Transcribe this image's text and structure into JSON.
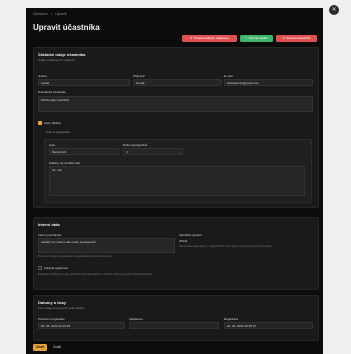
{
  "breadcrumb": {
    "parent": "Účastníci",
    "separator": ">",
    "current": "Upravit"
  },
  "page_title": "Upravit účastníka",
  "header_buttons": {
    "delete_pending": "Smazat čekající registrace",
    "approve": "Potvrdit platbu",
    "delete": "Smazat účastníka"
  },
  "basic": {
    "title": "Základní údaje účastníka",
    "subtitle": "Údaje uváděné při registraci",
    "first_name_label": "Jméno",
    "first_name_value": "Lukáš",
    "last_name_label": "Příjmení*",
    "last_name_value": "Novák",
    "email_label": "E-mail",
    "email_value": "lukasadmin@gmail.com",
    "note_label": "Poznámka účastníka",
    "note_value": "Mohla přijet sestřička",
    "driver_label": "Auto/ řidička",
    "car_section_label": "Auto a spolujezdci",
    "car_label": "Auto",
    "car_value": "Škoda 022",
    "seats_label": "Počet spolujezdců",
    "seats_value": "4",
    "extra_label": "Odkazy na sociální sítě",
    "extra_value": "IG: mia"
  },
  "internal": {
    "title": "Interní data",
    "note_label": "Interní poznámka",
    "note_value": "zaplatil na místě podle počtu spolujezdců",
    "note_hint": "Pouze pro účely zaměstnanců a organizátorů, účastník je nevidí",
    "symbol_label": "Variabilní symbol",
    "symbol_value": "28342",
    "symbol_hint": "Generován automaticky z registračních čísel, ale je možné jej upravit nebo přidat",
    "public_label": "Veřejná registrace",
    "public_hint": "Registrace přidaná z webu, účastník bude automaticky v interním dokumentu pro přehled registrací."
  },
  "dates": {
    "title": "Datumy a časy",
    "subtitle": "Tyto údaje se generují automaticky",
    "created_label": "Potvrzení registrace",
    "created_value": "05. 06. 2023 20:15:03",
    "paid_label": "Zaplaceno",
    "paid_value": "",
    "registered_label": "Registrace",
    "registered_value": "04. 06. 2023 18:30:27"
  },
  "footer": {
    "save": "Uložit",
    "cancel": "Zrušit"
  },
  "colors": {
    "accent": "#e8a33d",
    "danger": "#e05252",
    "success": "#3fb56b",
    "panel": "#0c0c0c"
  }
}
